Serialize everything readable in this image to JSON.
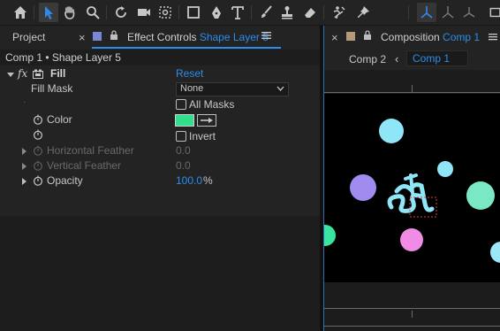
{
  "toolbar": {
    "tools": [
      "home-icon",
      "selection-tool-icon",
      "hand-tool-icon",
      "zoom-tool-icon",
      "rotate-tool-icon",
      "camera-tool-icon",
      "pan-behind-tool-icon",
      "rectangle-tool-icon",
      "pen-tool-icon",
      "type-tool-icon",
      "brush-tool-icon",
      "clone-stamp-tool-icon",
      "eraser-tool-icon",
      "roto-brush-tool-icon",
      "puppet-pin-tool-icon",
      "axis-local-icon",
      "axis-world-icon",
      "axis-view-icon",
      "workspace-icon"
    ]
  },
  "left_panel": {
    "project_tab": "Project",
    "effect_controls_prefix": "Effect Controls",
    "effect_controls_layer": "Shape Layer 5",
    "breadcrumb": "Comp 1 • Shape Layer 5",
    "effect": {
      "name": "Fill",
      "reset_label": "Reset",
      "fill_mask_label": "Fill Mask",
      "fill_mask_value": "None",
      "all_masks_label": "All Masks",
      "color_label": "Color",
      "invert_label": "Invert",
      "horizontal_feather_label": "Horizontal Feather",
      "horizontal_feather_value": "0.0",
      "vertical_feather_label": "Vertical Feather",
      "vertical_feather_value": "0.0",
      "opacity_label": "Opacity",
      "opacity_value": "100.0",
      "opacity_unit": "%",
      "color_value": "#31e08b"
    }
  },
  "right_panel": {
    "composition_prefix": "Composition",
    "composition_name": "Comp 1",
    "nav_comp2": "Comp 2",
    "nav_comp1": "Comp 1"
  },
  "colors": {
    "accent": "#2d8ceb",
    "dot_cyan": "#8ee6f6",
    "dot_purple": "#a08cf0",
    "dot_mint": "#7ae8c4",
    "dot_green": "#3ae3a0",
    "dot_pink": "#f08ce6",
    "dot_light": "#9be7f8"
  }
}
